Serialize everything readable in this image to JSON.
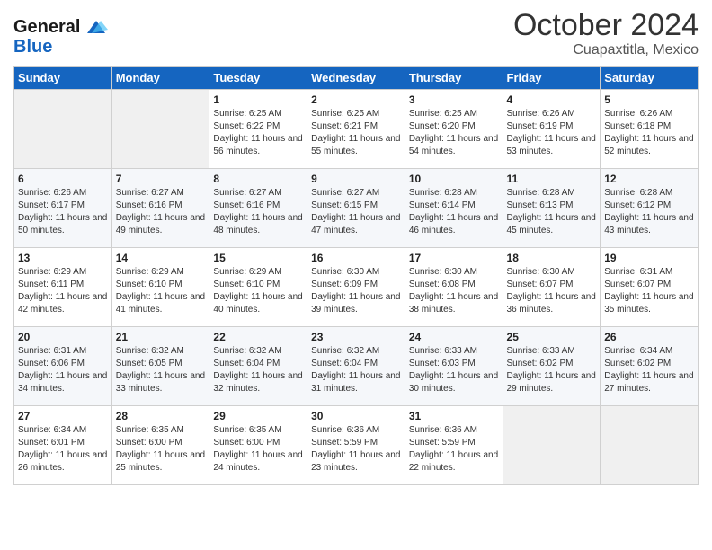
{
  "header": {
    "logo_line1": "General",
    "logo_line2": "Blue",
    "month": "October 2024",
    "location": "Cuapaxtitla, Mexico"
  },
  "days_of_week": [
    "Sunday",
    "Monday",
    "Tuesday",
    "Wednesday",
    "Thursday",
    "Friday",
    "Saturday"
  ],
  "weeks": [
    [
      {
        "day": "",
        "sunrise": "",
        "sunset": "",
        "daylight": ""
      },
      {
        "day": "",
        "sunrise": "",
        "sunset": "",
        "daylight": ""
      },
      {
        "day": "1",
        "sunrise": "Sunrise: 6:25 AM",
        "sunset": "Sunset: 6:22 PM",
        "daylight": "Daylight: 11 hours and 56 minutes."
      },
      {
        "day": "2",
        "sunrise": "Sunrise: 6:25 AM",
        "sunset": "Sunset: 6:21 PM",
        "daylight": "Daylight: 11 hours and 55 minutes."
      },
      {
        "day": "3",
        "sunrise": "Sunrise: 6:25 AM",
        "sunset": "Sunset: 6:20 PM",
        "daylight": "Daylight: 11 hours and 54 minutes."
      },
      {
        "day": "4",
        "sunrise": "Sunrise: 6:26 AM",
        "sunset": "Sunset: 6:19 PM",
        "daylight": "Daylight: 11 hours and 53 minutes."
      },
      {
        "day": "5",
        "sunrise": "Sunrise: 6:26 AM",
        "sunset": "Sunset: 6:18 PM",
        "daylight": "Daylight: 11 hours and 52 minutes."
      }
    ],
    [
      {
        "day": "6",
        "sunrise": "Sunrise: 6:26 AM",
        "sunset": "Sunset: 6:17 PM",
        "daylight": "Daylight: 11 hours and 50 minutes."
      },
      {
        "day": "7",
        "sunrise": "Sunrise: 6:27 AM",
        "sunset": "Sunset: 6:16 PM",
        "daylight": "Daylight: 11 hours and 49 minutes."
      },
      {
        "day": "8",
        "sunrise": "Sunrise: 6:27 AM",
        "sunset": "Sunset: 6:16 PM",
        "daylight": "Daylight: 11 hours and 48 minutes."
      },
      {
        "day": "9",
        "sunrise": "Sunrise: 6:27 AM",
        "sunset": "Sunset: 6:15 PM",
        "daylight": "Daylight: 11 hours and 47 minutes."
      },
      {
        "day": "10",
        "sunrise": "Sunrise: 6:28 AM",
        "sunset": "Sunset: 6:14 PM",
        "daylight": "Daylight: 11 hours and 46 minutes."
      },
      {
        "day": "11",
        "sunrise": "Sunrise: 6:28 AM",
        "sunset": "Sunset: 6:13 PM",
        "daylight": "Daylight: 11 hours and 45 minutes."
      },
      {
        "day": "12",
        "sunrise": "Sunrise: 6:28 AM",
        "sunset": "Sunset: 6:12 PM",
        "daylight": "Daylight: 11 hours and 43 minutes."
      }
    ],
    [
      {
        "day": "13",
        "sunrise": "Sunrise: 6:29 AM",
        "sunset": "Sunset: 6:11 PM",
        "daylight": "Daylight: 11 hours and 42 minutes."
      },
      {
        "day": "14",
        "sunrise": "Sunrise: 6:29 AM",
        "sunset": "Sunset: 6:10 PM",
        "daylight": "Daylight: 11 hours and 41 minutes."
      },
      {
        "day": "15",
        "sunrise": "Sunrise: 6:29 AM",
        "sunset": "Sunset: 6:10 PM",
        "daylight": "Daylight: 11 hours and 40 minutes."
      },
      {
        "day": "16",
        "sunrise": "Sunrise: 6:30 AM",
        "sunset": "Sunset: 6:09 PM",
        "daylight": "Daylight: 11 hours and 39 minutes."
      },
      {
        "day": "17",
        "sunrise": "Sunrise: 6:30 AM",
        "sunset": "Sunset: 6:08 PM",
        "daylight": "Daylight: 11 hours and 38 minutes."
      },
      {
        "day": "18",
        "sunrise": "Sunrise: 6:30 AM",
        "sunset": "Sunset: 6:07 PM",
        "daylight": "Daylight: 11 hours and 36 minutes."
      },
      {
        "day": "19",
        "sunrise": "Sunrise: 6:31 AM",
        "sunset": "Sunset: 6:07 PM",
        "daylight": "Daylight: 11 hours and 35 minutes."
      }
    ],
    [
      {
        "day": "20",
        "sunrise": "Sunrise: 6:31 AM",
        "sunset": "Sunset: 6:06 PM",
        "daylight": "Daylight: 11 hours and 34 minutes."
      },
      {
        "day": "21",
        "sunrise": "Sunrise: 6:32 AM",
        "sunset": "Sunset: 6:05 PM",
        "daylight": "Daylight: 11 hours and 33 minutes."
      },
      {
        "day": "22",
        "sunrise": "Sunrise: 6:32 AM",
        "sunset": "Sunset: 6:04 PM",
        "daylight": "Daylight: 11 hours and 32 minutes."
      },
      {
        "day": "23",
        "sunrise": "Sunrise: 6:32 AM",
        "sunset": "Sunset: 6:04 PM",
        "daylight": "Daylight: 11 hours and 31 minutes."
      },
      {
        "day": "24",
        "sunrise": "Sunrise: 6:33 AM",
        "sunset": "Sunset: 6:03 PM",
        "daylight": "Daylight: 11 hours and 30 minutes."
      },
      {
        "day": "25",
        "sunrise": "Sunrise: 6:33 AM",
        "sunset": "Sunset: 6:02 PM",
        "daylight": "Daylight: 11 hours and 29 minutes."
      },
      {
        "day": "26",
        "sunrise": "Sunrise: 6:34 AM",
        "sunset": "Sunset: 6:02 PM",
        "daylight": "Daylight: 11 hours and 27 minutes."
      }
    ],
    [
      {
        "day": "27",
        "sunrise": "Sunrise: 6:34 AM",
        "sunset": "Sunset: 6:01 PM",
        "daylight": "Daylight: 11 hours and 26 minutes."
      },
      {
        "day": "28",
        "sunrise": "Sunrise: 6:35 AM",
        "sunset": "Sunset: 6:00 PM",
        "daylight": "Daylight: 11 hours and 25 minutes."
      },
      {
        "day": "29",
        "sunrise": "Sunrise: 6:35 AM",
        "sunset": "Sunset: 6:00 PM",
        "daylight": "Daylight: 11 hours and 24 minutes."
      },
      {
        "day": "30",
        "sunrise": "Sunrise: 6:36 AM",
        "sunset": "Sunset: 5:59 PM",
        "daylight": "Daylight: 11 hours and 23 minutes."
      },
      {
        "day": "31",
        "sunrise": "Sunrise: 6:36 AM",
        "sunset": "Sunset: 5:59 PM",
        "daylight": "Daylight: 11 hours and 22 minutes."
      },
      {
        "day": "",
        "sunrise": "",
        "sunset": "",
        "daylight": ""
      },
      {
        "day": "",
        "sunrise": "",
        "sunset": "",
        "daylight": ""
      }
    ]
  ]
}
